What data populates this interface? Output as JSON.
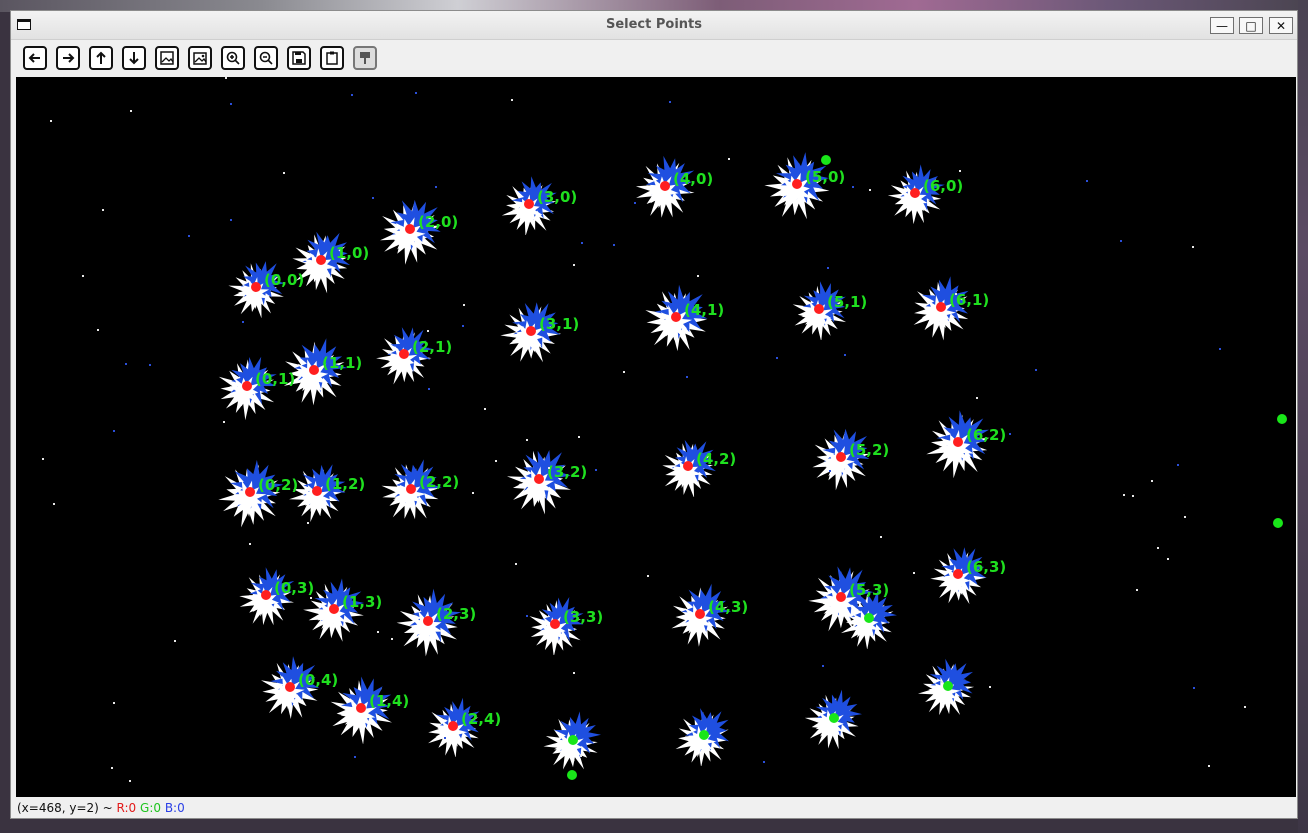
{
  "window": {
    "title": "Select Points",
    "controls": {
      "minimize": "—",
      "maximize": "□",
      "close": "✕"
    }
  },
  "toolbar": {
    "buttons": [
      {
        "name": "pan-left-button",
        "icon": "arrow-left-icon"
      },
      {
        "name": "pan-right-button",
        "icon": "arrow-right-icon"
      },
      {
        "name": "pan-up-button",
        "icon": "arrow-up-icon"
      },
      {
        "name": "pan-down-button",
        "icon": "arrow-down-icon"
      },
      {
        "name": "zoom-fit-button",
        "icon": "image-icon"
      },
      {
        "name": "zoom-original-button",
        "icon": "image-detail-icon"
      },
      {
        "name": "zoom-in-button",
        "icon": "zoom-in-icon"
      },
      {
        "name": "zoom-out-button",
        "icon": "zoom-out-icon"
      },
      {
        "name": "save-button",
        "icon": "save-icon"
      },
      {
        "name": "copy-button",
        "icon": "clipboard-icon"
      },
      {
        "name": "properties-button",
        "icon": "paint-brush-icon",
        "disabled": true
      }
    ]
  },
  "points": [
    {
      "label": "(0,0)"
    },
    {
      "label": "(1,0)"
    },
    {
      "label": "(2,0)"
    },
    {
      "label": "(3,0)"
    },
    {
      "label": "(4,0)"
    },
    {
      "label": "(5,0)"
    },
    {
      "label": "(6,0)"
    },
    {
      "label": "(0,1)"
    },
    {
      "label": "(1,1)"
    },
    {
      "label": "(2,1)"
    },
    {
      "label": "(3,1)"
    },
    {
      "label": "(4,1)"
    },
    {
      "label": "(5,1)"
    },
    {
      "label": "(6,1)"
    },
    {
      "label": "(0,2)"
    },
    {
      "label": "(1,2)"
    },
    {
      "label": "(2,2)"
    },
    {
      "label": "(3,2)"
    },
    {
      "label": "(4,2)"
    },
    {
      "label": "(5,2)"
    },
    {
      "label": "(6,2)"
    },
    {
      "label": "(0,3)"
    },
    {
      "label": "(1,3)"
    },
    {
      "label": "(2,3)"
    },
    {
      "label": "(3,3)"
    },
    {
      "label": "(4,3)"
    },
    {
      "label": "(5,3)"
    },
    {
      "label": "(6,3)"
    },
    {
      "label": "(0,4)"
    },
    {
      "label": "(1,4)"
    },
    {
      "label": "(2,4)"
    }
  ],
  "statusbar": {
    "coords": "(x=468, y=2) ~ ",
    "r": "R:0",
    "g": "G:0",
    "b": "B:0"
  },
  "colors": {
    "marker_selected": "#ff1f1f",
    "marker_candidate": "#19e619",
    "label": "#1fe01f",
    "blob_blue": "#1f4fe0",
    "blob_white": "#ffffff"
  }
}
